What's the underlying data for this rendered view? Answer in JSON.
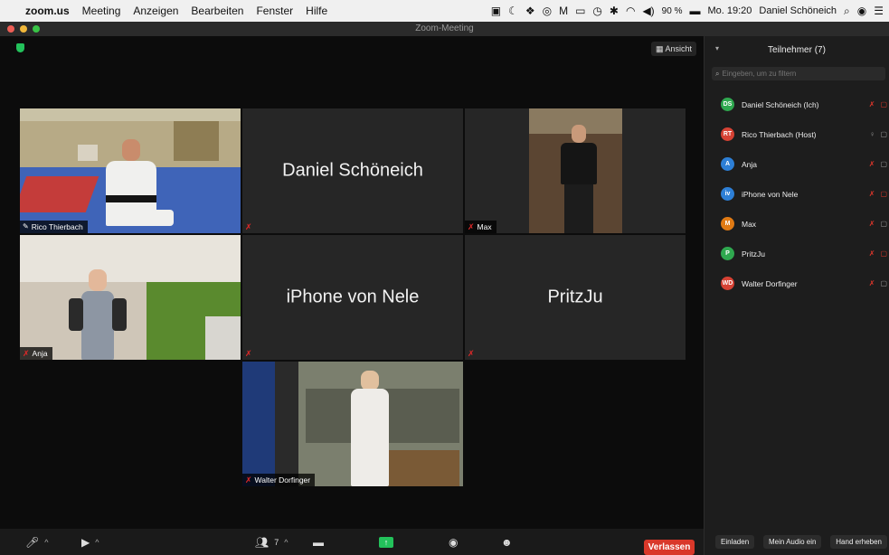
{
  "menubar": {
    "app": "zoom.us",
    "items": [
      "Meeting",
      "Anzeigen",
      "Bearbeiten",
      "Fenster",
      "Hilfe"
    ],
    "battery": "90 %",
    "clock": "Mo. 19:20",
    "user": "Daniel Schöneich"
  },
  "window": {
    "title": "Zoom-Meeting"
  },
  "main": {
    "view_label": "Ansicht"
  },
  "tiles": [
    {
      "name": "Rico Thierbach",
      "big": ""
    },
    {
      "name": "",
      "big": "Daniel Schöneich"
    },
    {
      "name": "Max",
      "big": ""
    },
    {
      "name": "Anja",
      "big": ""
    },
    {
      "name": "",
      "big": "iPhone von Nele"
    },
    {
      "name": "",
      "big": "PritzJu"
    },
    {
      "name": "Walter Dorfinger",
      "big": ""
    }
  ],
  "toolbar": {
    "participants_count": "7",
    "leave_label": "Verlassen"
  },
  "panel": {
    "title": "Teilnehmer (7)",
    "search_placeholder": "Eingeben, um zu filtern",
    "participants": [
      {
        "initials": "DS",
        "name": "Daniel Schöneich (Ich)",
        "color": "#2fa84f"
      },
      {
        "initials": "RT",
        "name": "Rico Thierbach (Host)",
        "color": "#d64234"
      },
      {
        "initials": "A",
        "name": "Anja",
        "color": "#2d7fd6"
      },
      {
        "initials": "iv",
        "name": "iPhone von Nele",
        "color": "#2d7fd6"
      },
      {
        "initials": "M",
        "name": "Max",
        "color": "#e07a14"
      },
      {
        "initials": "P",
        "name": "PritzJu",
        "color": "#2fa84f"
      },
      {
        "initials": "WD",
        "name": "Walter Dorfinger",
        "color": "#d64234"
      }
    ],
    "footer": {
      "invite": "Einladen",
      "unmute": "Mein Audio ein",
      "raise_hand": "Hand erheben"
    }
  }
}
